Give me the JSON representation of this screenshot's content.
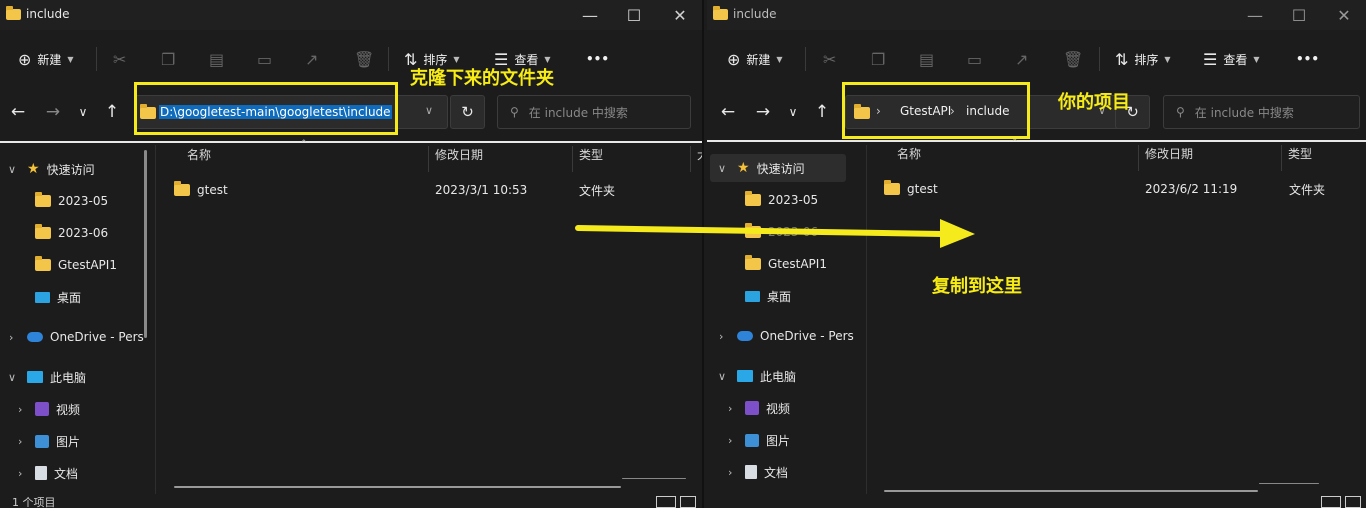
{
  "left_window": {
    "title": "include",
    "toolbar": {
      "new_label": "新建",
      "sort_label": "排序",
      "view_label": "查看",
      "more_label": "•••"
    },
    "address": {
      "path": "D:\\googletest-main\\googletest\\include"
    },
    "search_placeholder": "在 include 中搜索",
    "columns": [
      "名称",
      "修改日期",
      "类型",
      "大"
    ],
    "files": [
      {
        "name": "gtest",
        "modified": "2023/3/1 10:53",
        "type": "文件夹"
      }
    ],
    "sidebar": {
      "quick_access": "快速访问",
      "items": [
        "2023-05",
        "2023-06",
        "GtestAPI1",
        "桌面"
      ],
      "onedrive": "OneDrive - Pers",
      "this_pc": "此电脑",
      "pc_items": [
        "视频",
        "图片",
        "文档"
      ]
    },
    "status": "1 个项目"
  },
  "right_window": {
    "title": "include",
    "toolbar": {
      "new_label": "新建",
      "sort_label": "排序",
      "view_label": "查看",
      "more_label": "•••"
    },
    "breadcrumb": [
      "GtestAPI",
      "include"
    ],
    "search_placeholder": "在 include 中搜索",
    "columns": [
      "名称",
      "修改日期",
      "类型"
    ],
    "files": [
      {
        "name": "gtest",
        "modified": "2023/6/2 11:19",
        "type": "文件夹"
      }
    ],
    "sidebar": {
      "quick_access": "快速访问",
      "items": [
        "2023-05",
        "2023-06",
        "GtestAPI1",
        "桌面"
      ],
      "onedrive": "OneDrive - Pers",
      "this_pc": "此电脑",
      "pc_items": [
        "视频",
        "图片",
        "文档"
      ]
    }
  },
  "annotations": {
    "clone_label": "克隆下来的文件夹",
    "project_label": "你的项目",
    "copy_label": "复制到这里",
    "color": "#f5eb1c"
  }
}
